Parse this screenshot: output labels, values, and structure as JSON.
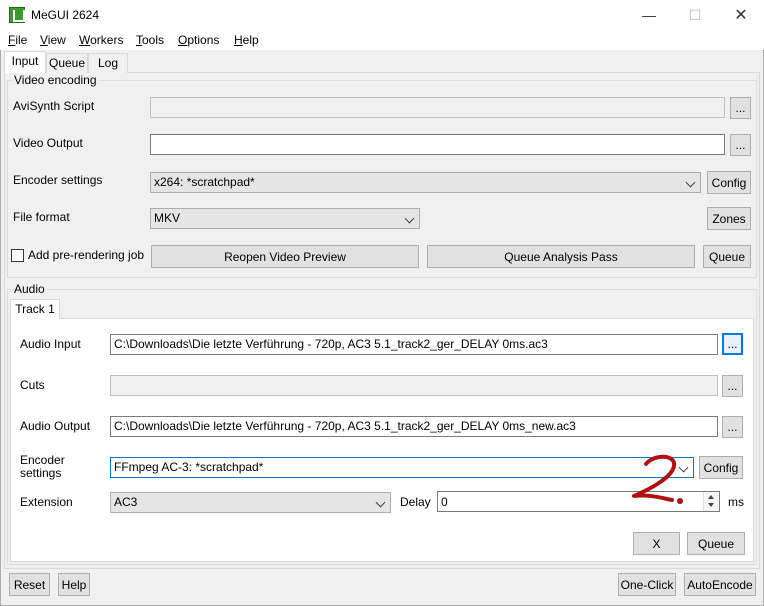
{
  "window": {
    "title": "MeGUI 2624",
    "minimize": "—",
    "maximize": "☐",
    "close": "✕"
  },
  "menu": {
    "items": [
      {
        "mnemonic": "F",
        "rest": "ile"
      },
      {
        "mnemonic": "V",
        "rest": "iew"
      },
      {
        "mnemonic": "W",
        "rest": "orkers"
      },
      {
        "mnemonic": "T",
        "rest": "ools"
      },
      {
        "mnemonic": "O",
        "rest": "ptions"
      },
      {
        "mnemonic": "H",
        "rest": "elp"
      }
    ]
  },
  "tabs": [
    "Input",
    "Queue",
    "Log"
  ],
  "video": {
    "group_label": "Video encoding",
    "avisynth_label": "AviSynth Script",
    "avisynth_value": "",
    "browse": "...",
    "output_label": "Video Output",
    "output_value": "",
    "encoder_label": "Encoder settings",
    "encoder_value": "x264: *scratchpad*",
    "config": "Config",
    "format_label": "File format",
    "format_value": "MKV",
    "zones": "Zones",
    "prerender_label": "Add pre-rendering job",
    "prerender_checked": false,
    "reopen_preview": "Reopen Video Preview",
    "queue_analysis": "Queue Analysis Pass",
    "queue": "Queue"
  },
  "audio": {
    "group_label": "Audio",
    "track_tab": "Track 1",
    "input_label": "Audio Input",
    "input_value": "C:\\Downloads\\Die letzte Verführung - 720p, AC3 5.1_track2_ger_DELAY 0ms.ac3",
    "browse": "...",
    "cuts_label": "Cuts",
    "cuts_value": "",
    "output_label": "Audio Output",
    "output_value": "C:\\Downloads\\Die letzte Verführung - 720p, AC3 5.1_track2_ger_DELAY 0ms_new.ac3",
    "encoder_label": "Encoder settings",
    "encoder_value": "FFmpeg AC-3: *scratchpad*",
    "config": "Config",
    "extension_label": "Extension",
    "extension_value": "AC3",
    "delay_label": "Delay",
    "delay_value": "0",
    "delay_unit": "ms",
    "x_button": "X",
    "queue": "Queue"
  },
  "bottom": {
    "reset": "Reset",
    "help": "Help",
    "one_click": "One-Click",
    "auto_encode": "AutoEncode"
  },
  "annotation_color": "#b01010"
}
